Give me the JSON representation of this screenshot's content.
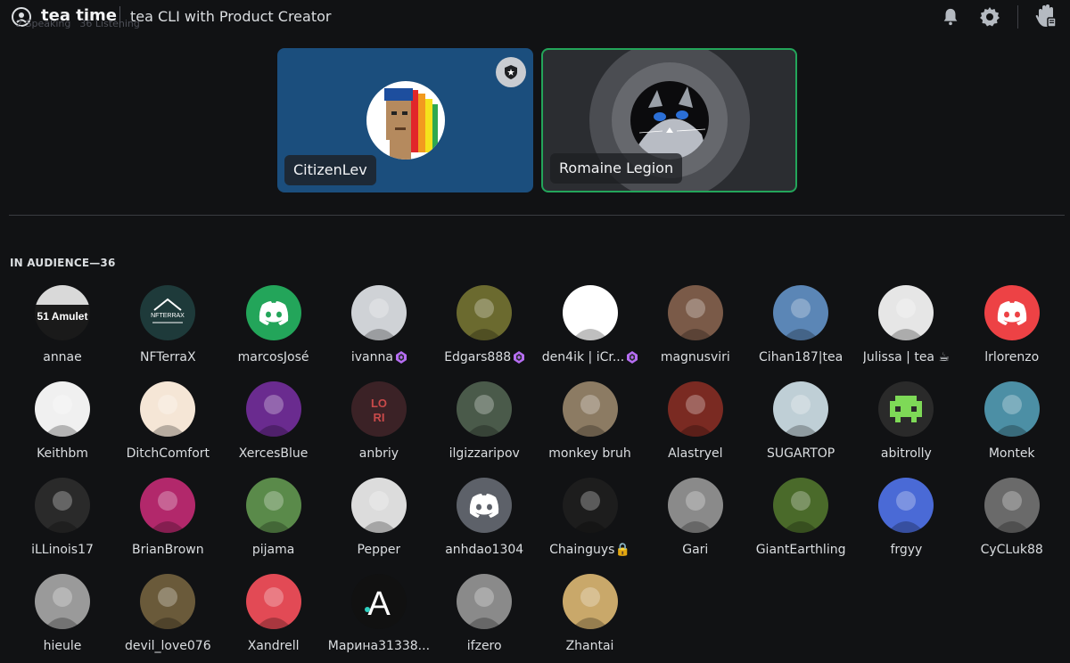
{
  "header": {
    "server_name": "tea time",
    "stage_title": "tea CLI with Product Creator",
    "speaking": "2 Speaking",
    "listening": "36 Listening"
  },
  "speakers": [
    {
      "name": "CitizenLev",
      "avatar": "pixel-punk-rainbow",
      "moderator": true,
      "bg": "#1b4e7d"
    },
    {
      "name": "Romaine Legion",
      "avatar": "cat-photo",
      "speaking": true,
      "bg": "#2b2d31"
    }
  ],
  "audience": {
    "heading": "IN AUDIENCE—36",
    "members": [
      {
        "name": "annae",
        "color": "#d9d9d9",
        "label": "Amulet",
        "kind": "logo-amulet"
      },
      {
        "name": "NFTerraX",
        "color": "#1e3a3a",
        "label": "NFTERRAX",
        "kind": "logo-nfterrax"
      },
      {
        "name": "marcosJosé",
        "color": "#23a55a",
        "kind": "discord"
      },
      {
        "name": "ivanna",
        "color": "#cfd2d6",
        "kind": "photo",
        "badge": true
      },
      {
        "name": "Edgars888",
        "color": "#6b6a2f",
        "kind": "photo",
        "badge": true
      },
      {
        "name": "den4ik | iCr...",
        "color": "#ffffff",
        "kind": "photo",
        "badge": true
      },
      {
        "name": "magnusviri",
        "color": "#7a5a48",
        "kind": "photo"
      },
      {
        "name": "Cihan187|tea",
        "color": "#5b86b6",
        "kind": "photo"
      },
      {
        "name": "Julissa | tea ☕",
        "color": "#e6e6e6",
        "kind": "photo"
      },
      {
        "name": "lrlorenzo",
        "color": "#ed4245",
        "kind": "discord"
      },
      {
        "name": "Keithbm",
        "color": "#f0f0f0",
        "kind": "photo"
      },
      {
        "name": "DitchComfort",
        "color": "#f5e6d6",
        "kind": "photo"
      },
      {
        "name": "XercesBlue",
        "color": "#6a2b8f",
        "kind": "photo"
      },
      {
        "name": "anbriy",
        "color": "#3b2226",
        "label": "LORI",
        "kind": "logo-lori"
      },
      {
        "name": "ilgizzaripov",
        "color": "#4a5a4a",
        "kind": "photo"
      },
      {
        "name": "monkey bruh",
        "color": "#8c7b63",
        "kind": "photo"
      },
      {
        "name": "Alastryel",
        "color": "#7a2a22",
        "kind": "photo"
      },
      {
        "name": "SUGARTOP",
        "color": "#bfcfd6",
        "kind": "photo"
      },
      {
        "name": "abitrolly",
        "color": "#2a2a2a",
        "kind": "invader"
      },
      {
        "name": "Montek",
        "color": "#4c8fa5",
        "kind": "photo"
      },
      {
        "name": "iLLinois17",
        "color": "#2a2a2a",
        "kind": "photo"
      },
      {
        "name": "BrianBrown",
        "color": "#b2286b",
        "kind": "photo"
      },
      {
        "name": "pijama",
        "color": "#5a8a4a",
        "kind": "photo"
      },
      {
        "name": "Pepper",
        "color": "#dcdcdc",
        "kind": "photo"
      },
      {
        "name": "anhdao1304",
        "color": "#5d6169",
        "kind": "discord"
      },
      {
        "name": "Chainguys🔒",
        "color": "#1d1d1d",
        "kind": "photo"
      },
      {
        "name": "Gari",
        "color": "#8a8a8a",
        "kind": "photo"
      },
      {
        "name": "GiantEarthling",
        "color": "#4a6a2a",
        "kind": "photo"
      },
      {
        "name": "frgyy",
        "color": "#4a6ad6",
        "kind": "photo"
      },
      {
        "name": "CyCLuk88",
        "color": "#6a6a6a",
        "kind": "photo"
      },
      {
        "name": "hieule",
        "color": "#9a9a9a",
        "kind": "photo"
      },
      {
        "name": "devil_love076",
        "color": "#6a5a3a",
        "kind": "photo"
      },
      {
        "name": "Xandrell",
        "color": "#e24a55",
        "kind": "photo"
      },
      {
        "name": "Марина31338...",
        "color": "#111111",
        "label": "A",
        "kind": "logo-a"
      },
      {
        "name": "ifzero",
        "color": "#8a8a8a",
        "kind": "photo"
      },
      {
        "name": "Zhantai",
        "color": "#c9a86a",
        "kind": "photo"
      }
    ]
  },
  "colors": {
    "background": "#111214",
    "speaking_ring": "#23a55a",
    "nitro_badge": "#b66df2"
  }
}
